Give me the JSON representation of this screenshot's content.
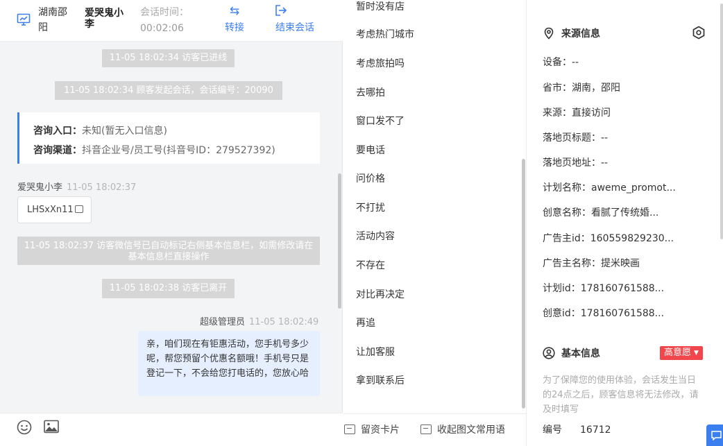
{
  "header": {
    "location": "湖南邵阳",
    "visitor_name": "爱哭鬼小李",
    "session_time_label": "会话时间：",
    "session_time": "00:02:06",
    "transfer_label": "转接",
    "end_label": "结束会话",
    "accent": "#3a7ef0"
  },
  "chat": {
    "sys1": "11-05 18:02:34 访客已进线",
    "sys2": "11-05 18:02:34 顾客发起会话，会话编号：20090",
    "card": {
      "entry_label": "咨询入口：",
      "entry_value": "未知(暂无入口信息)",
      "channel_label": "咨询渠道：",
      "channel_value": "抖音企业号/员工号(抖音号ID：279527392)"
    },
    "visitor_msg": {
      "sender": "爱哭鬼小李",
      "time": "11-05 18:02:37",
      "text": "LHSxXn11"
    },
    "sys3": "11-05 18:02:37 访客微信号已自动标记右侧基本信息栏，如需修改请在基本信息栏直接操作",
    "sys4": "11-05 18:02:38 访客已离开",
    "agent_msg": {
      "sender": "超级管理员",
      "time": "11-05 18:02:49",
      "text": "亲，咱们现在有钜惠活动，您手机号多少呢，帮您预留个优惠名额哦！手机号只是登记一下，不会给您打电话的，您放心哈"
    }
  },
  "quick_replies": [
    "暂时没有店",
    "考虑热门城市",
    "考虑旅拍吗",
    "去哪拍",
    "窗口发不了",
    "要电话",
    "问价格",
    "不打扰",
    "活动内容",
    "不存在",
    "对比再决定",
    "再追",
    "让加客服",
    "拿到联系后"
  ],
  "quick_footer": {
    "card_label": "留资卡片",
    "collapse_label": "收起图文常用语"
  },
  "side": {
    "source_title": "来源信息",
    "source_rows": [
      "设备：--",
      "省市：湖南，邵阳",
      "来源：直接访问",
      "落地页标题：--",
      "落地页地址：--",
      "计划名称：aweme_promot...",
      "创意名称：看腻了传统婚...",
      "广告主id：160559829230...",
      "广告主名称：提米映画",
      "计划id：178160761588...",
      "创意id：178160761588..."
    ],
    "basic_title": "基本信息",
    "badge": "高意愿",
    "note": "为了保障您的使用体验，会话发生当日的24点之后，顾客信息将无法修改，请及时填写",
    "id_label": "编号",
    "id_value": "16712",
    "badge_color": "#f0464c"
  }
}
